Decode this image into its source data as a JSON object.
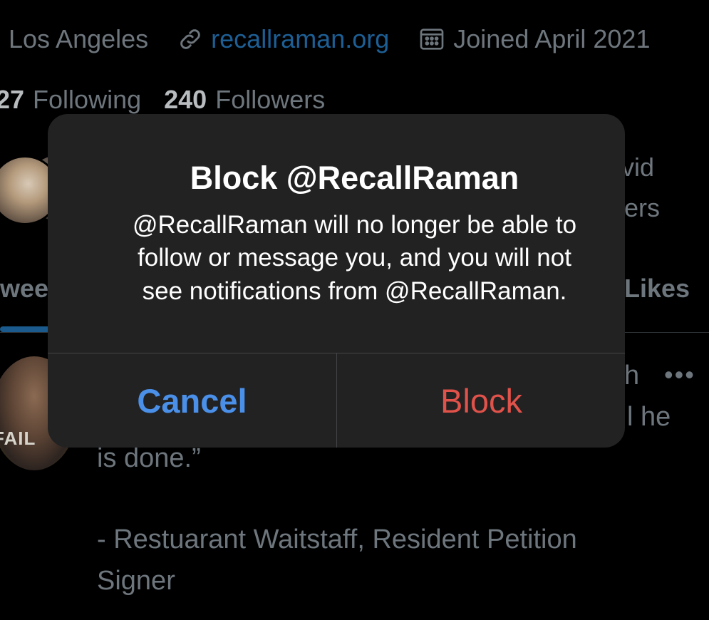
{
  "profile": {
    "location": "Los Angeles",
    "website": "recallraman.org",
    "joined": "Joined April 2021",
    "following_count": "27",
    "following_label": "Following",
    "followers_count": "240",
    "followers_label": "Followers",
    "followed_by_fragment_1": "vid",
    "followed_by_fragment_2": "ers",
    "colors": {
      "muted_text": "#6e767d",
      "link": "#1d5f95"
    }
  },
  "tabs": {
    "left_fragment": "wee",
    "right_fragment": "Likes",
    "active_underline_color": "#1a5a8c"
  },
  "tweet": {
    "avatar_text": "FAIL",
    "header_fragment": "h",
    "more_icon": "more-horizontal-icon",
    "line_fragment": "l he",
    "line_1": "is done.”",
    "line_2": "- Restuarant Waitstaff, Resident Petition",
    "line_3": "Signer"
  },
  "dialog": {
    "title": "Block @RecallRaman",
    "message_lines": [
      "@RecallRaman will no longer be able to",
      "follow or message you, and you will not",
      "see notifications from @RecallRaman."
    ],
    "cancel_label": "Cancel",
    "block_label": "Block",
    "colors": {
      "background": "#222223",
      "cancel": "#4a90e9",
      "block": "#e0524a"
    }
  },
  "icons": {
    "link": "link-icon",
    "calendar": "calendar-icon"
  }
}
